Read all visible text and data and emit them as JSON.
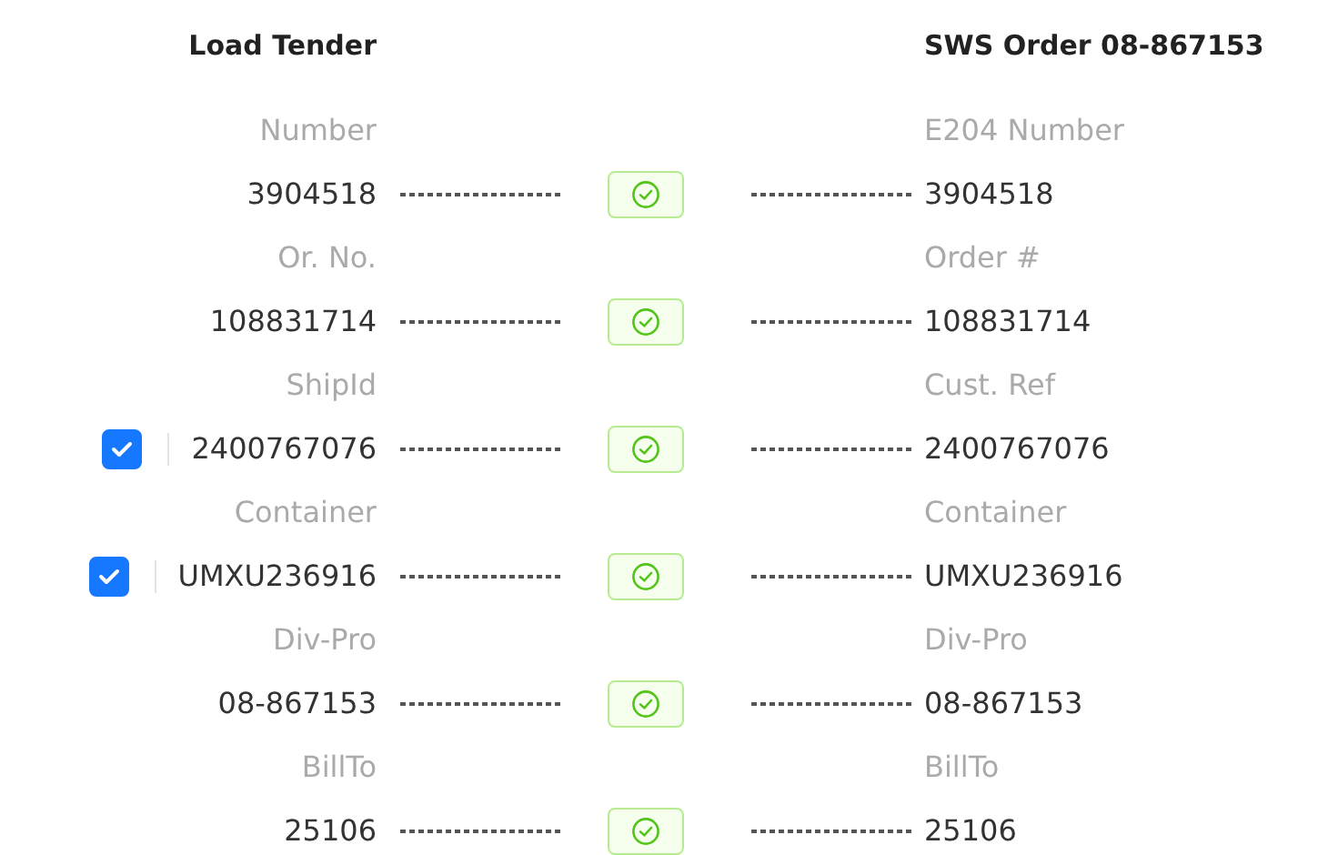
{
  "headers": {
    "left": "Load Tender",
    "right": "SWS Order 08-867153"
  },
  "rows": [
    {
      "kind": "plain",
      "left_label": "Number",
      "left_value": "3904518",
      "right_label": "E204 Number",
      "right_value": "3904518"
    },
    {
      "kind": "plain",
      "left_label": "Or. No.",
      "left_value": "108831714",
      "right_label": "Order #",
      "right_value": "108831714"
    },
    {
      "kind": "checkbox",
      "checked": true,
      "left_label": "ShipId",
      "left_value": "2400767076",
      "right_label": "Cust. Ref",
      "right_value": "2400767076"
    },
    {
      "kind": "checkbox",
      "checked": true,
      "left_label": "Container",
      "left_value": "UMXU236916",
      "right_label": "Container",
      "right_value": "UMXU236916"
    },
    {
      "kind": "plain",
      "left_label": "Div-Pro",
      "left_value": "08-867153",
      "right_label": "Div-Pro",
      "right_value": "08-867153"
    },
    {
      "kind": "plain",
      "left_label": "BillTo",
      "left_value": "25106",
      "right_label": "BillTo",
      "right_value": "25106"
    }
  ]
}
